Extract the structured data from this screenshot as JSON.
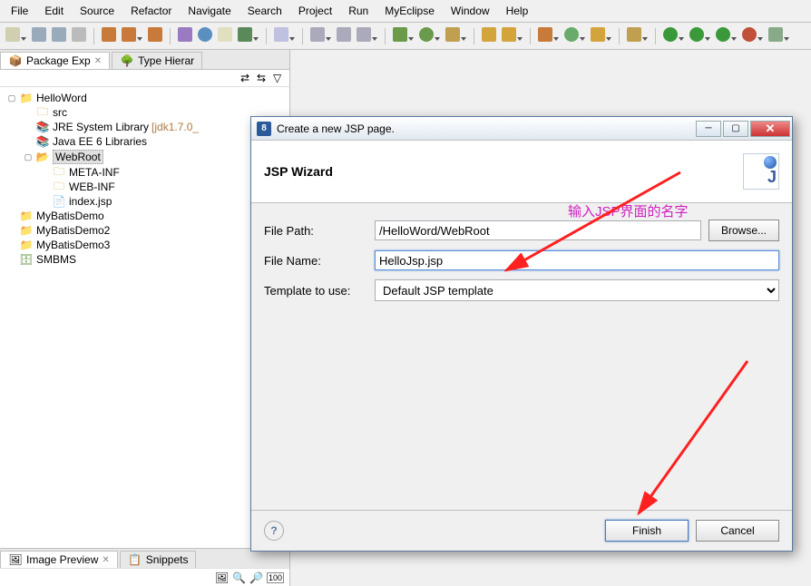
{
  "menu": {
    "file": "File",
    "edit": "Edit",
    "source": "Source",
    "refactor": "Refactor",
    "navigate": "Navigate",
    "search": "Search",
    "project": "Project",
    "run": "Run",
    "myeclipse": "MyEclipse",
    "window": "Window",
    "help": "Help"
  },
  "tabs": {
    "pkg_exp": "Package Exp",
    "type_hier": "Type Hierar",
    "image_preview": "Image Preview",
    "snippets": "Snippets"
  },
  "tree": {
    "helloword": "HelloWord",
    "src": "src",
    "jre": "JRE System Library",
    "jre_suffix": " [jdk1.7.0_",
    "javaee": "Java EE 6 Libraries",
    "webroot": "WebRoot",
    "metainf": "META-INF",
    "webinf": "WEB-INF",
    "indexjsp": "index.jsp",
    "mybatisdemo": "MyBatisDemo",
    "mybatisdemo2": "MyBatisDemo2",
    "mybatisdemo3": "MyBatisDemo3",
    "smbms": "SMBMS"
  },
  "dialog": {
    "title": "Create a new JSP page.",
    "header": "JSP Wizard",
    "filepath_label": "File Path:",
    "filepath_value": "/HelloWord/WebRoot",
    "browse": "Browse...",
    "filename_label": "File Name:",
    "filename_value": "HelloJsp.jsp",
    "template_label": "Template to use:",
    "template_value": "Default JSP template",
    "finish": "Finish",
    "cancel": "Cancel"
  },
  "annotation": {
    "text": "输入JSP界面的名字"
  }
}
